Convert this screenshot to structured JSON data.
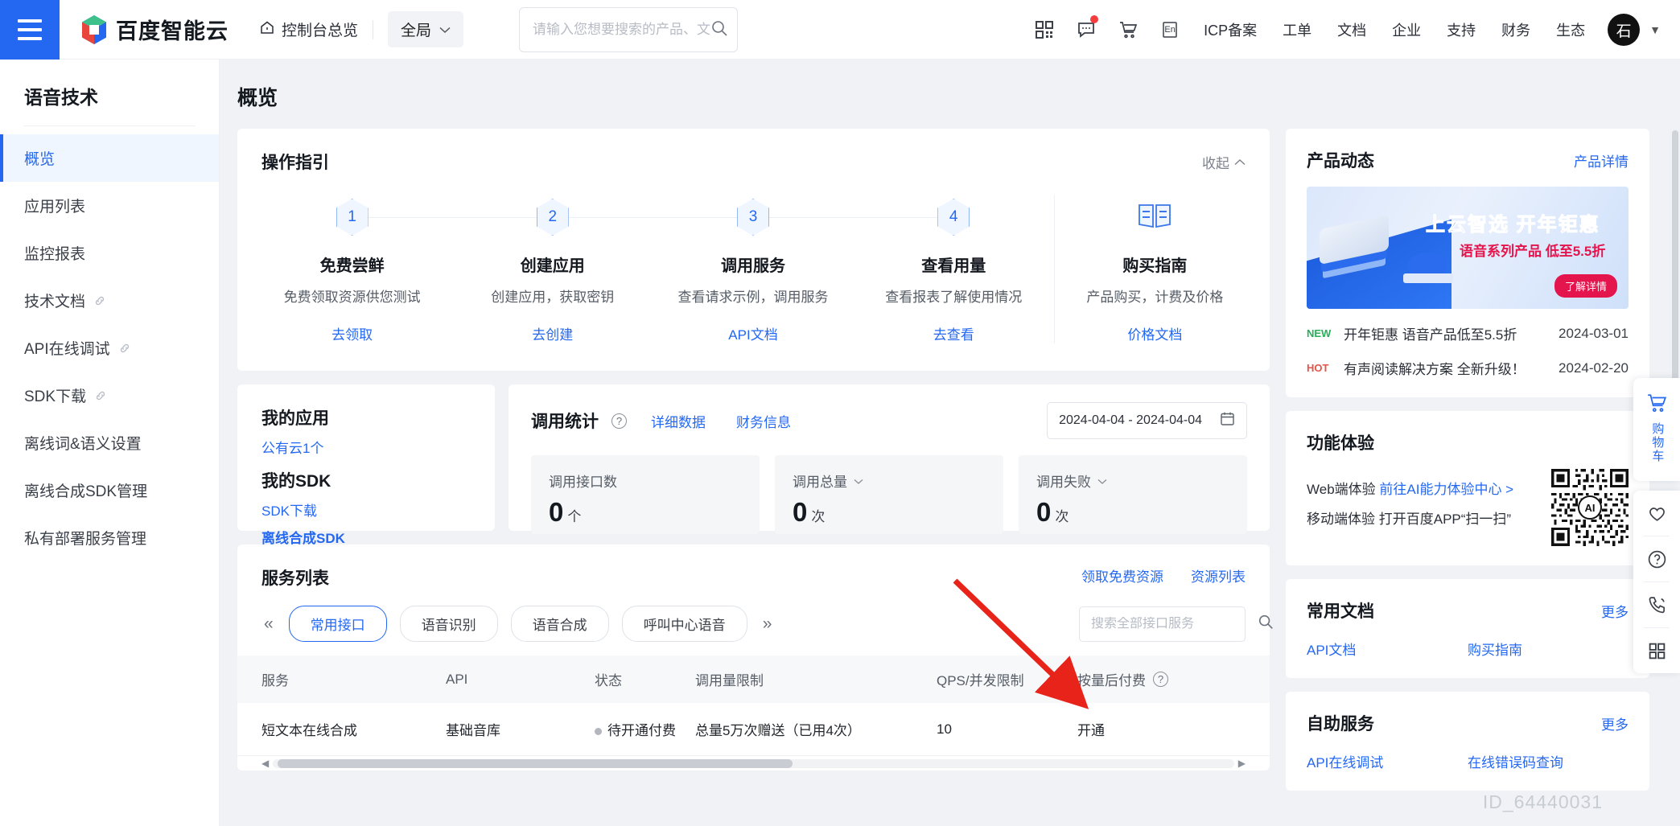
{
  "header": {
    "menu_icon": "hamburger-icon",
    "brand": "百度智能云",
    "console_link": "控制台总览",
    "region": "全局",
    "search": {
      "placeholder": "请输入您想要搜索的产品、文档",
      "value": ""
    },
    "icons": [
      "qrcode-icon",
      "message-icon",
      "cart-icon",
      "language-en-icon"
    ],
    "nav": [
      "ICP备案",
      "工单",
      "文档",
      "企业",
      "支持",
      "财务",
      "生态"
    ],
    "avatar": "石"
  },
  "sidebar": {
    "title": "语音技术",
    "items": [
      {
        "label": "概览",
        "active": true,
        "external": false
      },
      {
        "label": "应用列表",
        "active": false,
        "external": false
      },
      {
        "label": "监控报表",
        "active": false,
        "external": false
      },
      {
        "label": "技术文档",
        "active": false,
        "external": true
      },
      {
        "label": "API在线调试",
        "active": false,
        "external": true
      },
      {
        "label": "SDK下载",
        "active": false,
        "external": true
      },
      {
        "label": "离线词&语义设置",
        "active": false,
        "external": false
      },
      {
        "label": "离线合成SDK管理",
        "active": false,
        "external": false
      },
      {
        "label": "私有部署服务管理",
        "active": false,
        "external": false
      }
    ]
  },
  "page": {
    "title": "概览"
  },
  "guide": {
    "title": "操作指引",
    "collapse_label": "收起",
    "steps": [
      {
        "num": "1",
        "name": "免费尝鲜",
        "desc": "免费领取资源供您测试",
        "link": "去领取"
      },
      {
        "num": "2",
        "name": "创建应用",
        "desc": "创建应用，获取密钥",
        "link": "去创建"
      },
      {
        "num": "3",
        "name": "调用服务",
        "desc": "查看请求示例，调用服务",
        "link": "API文档"
      },
      {
        "num": "4",
        "name": "查看用量",
        "desc": "查看报表了解使用情况",
        "link": "去查看"
      }
    ],
    "last_step": {
      "icon": "book-icon",
      "name": "购买指南",
      "desc": "产品购买，计费及价格",
      "link": "价格文档"
    }
  },
  "apps": {
    "my_apps_title": "我的应用",
    "my_apps_link": "公有云1个",
    "my_sdk_title": "我的SDK",
    "sdk_links": [
      "SDK下载",
      "离线合成SDK"
    ]
  },
  "stats": {
    "title": "调用统计",
    "help_icon": "question-icon",
    "links": [
      "详细数据",
      "财务信息"
    ],
    "date_range": "2024-04-04 - 2024-04-04",
    "calendar_icon": "calendar-icon",
    "tiles": [
      {
        "label": "调用接口数",
        "value": "0",
        "unit": "个",
        "dropdown": false
      },
      {
        "label": "调用总量",
        "value": "0",
        "unit": "次",
        "dropdown": true
      },
      {
        "label": "调用失败",
        "value": "0",
        "unit": "次",
        "dropdown": true
      }
    ]
  },
  "services": {
    "title": "服务列表",
    "links": [
      "领取免费资源",
      "资源列表"
    ],
    "prev_icon": "double-chevron-left-icon",
    "next_icon": "double-chevron-right-icon",
    "tabs": [
      {
        "label": "常用接口",
        "active": true
      },
      {
        "label": "语音识别",
        "active": false
      },
      {
        "label": "语音合成",
        "active": false
      },
      {
        "label": "呼叫中心语音",
        "active": false
      }
    ],
    "search": {
      "placeholder": "搜索全部接口服务",
      "value": ""
    },
    "columns": [
      "服务",
      "API",
      "状态",
      "调用量限制",
      "QPS/并发限制",
      "按量后付费"
    ],
    "columns_help_icon": "question-icon",
    "rows": [
      {
        "service": "短文本在线合成",
        "api": "基础音库",
        "status": "待开通付费",
        "quota": "总量5万次赠送（已用4次）",
        "qps": "10",
        "postpaid": "开通"
      }
    ]
  },
  "product_news": {
    "title": "产品动态",
    "more": "产品详情",
    "banner": {
      "headline_a": "上云智选 开年",
      "headline_b": "钜惠",
      "subline": "语音系列产品 低至5.5折",
      "cta": "了解详情"
    },
    "items": [
      {
        "tag": "NEW",
        "text": "开年钜惠 语音产品低至5.5折",
        "date": "2024-03-01"
      },
      {
        "tag": "HOT",
        "text": "有声阅读解决方案 全新升级！",
        "date": "2024-02-20"
      }
    ]
  },
  "feature_trial": {
    "title": "功能体验",
    "web_label": "Web端体验",
    "web_link": "前往AI能力体验中心 >",
    "mobile_label": "移动端体验",
    "mobile_text": "打开百度APP“扫一扫”",
    "qr_icon": "qr-code-ai-icon"
  },
  "common_docs": {
    "title": "常用文档",
    "more": "更多",
    "links": [
      "API文档",
      "购买指南"
    ]
  },
  "self_service": {
    "title": "自助服务",
    "more": "更多",
    "links": [
      "API在线调试",
      "在线错误码查询"
    ]
  },
  "right_rail": {
    "cart_icon": "cart-icon",
    "cart_label": "购物车",
    "icons": [
      "heart-icon",
      "question-circle-icon",
      "phone-support-icon",
      "grid-apps-icon"
    ]
  },
  "watermark": "ID_64440031",
  "colors": {
    "brand_blue": "#2468f2",
    "link_blue": "#2468f2",
    "page_bg": "#f0f2f5",
    "card_bg": "#ffffff",
    "new_tag": "#2aae5a",
    "hot_tag": "#e1554a",
    "promo_red": "#e4144c",
    "annotation_arrow": "#e8241a"
  }
}
